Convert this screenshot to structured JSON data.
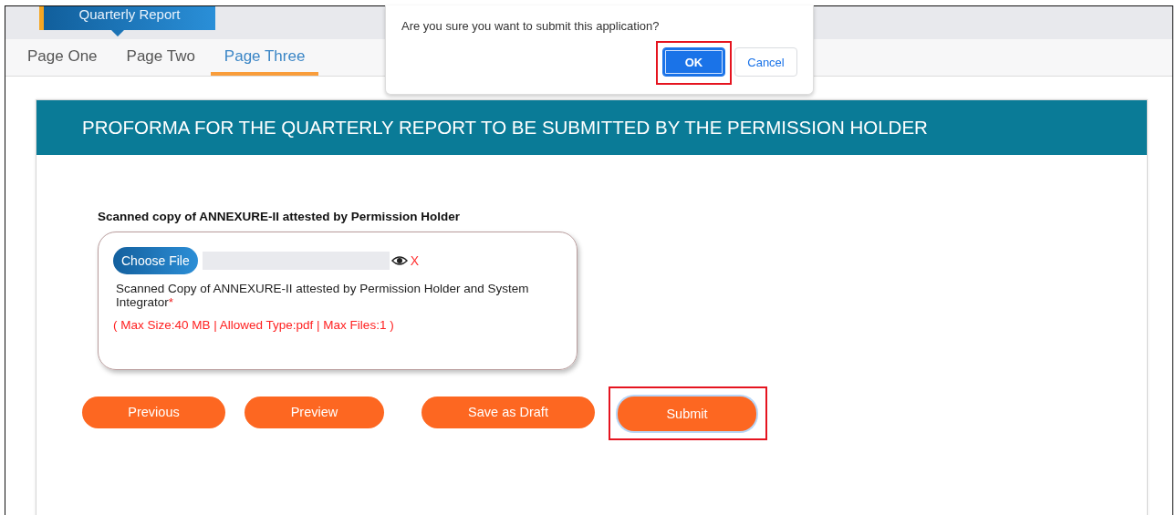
{
  "banner": {
    "title": "Quarterly Report"
  },
  "tabs": [
    {
      "label": "Page One",
      "selected": false
    },
    {
      "label": "Page Two",
      "selected": false
    },
    {
      "label": "Page Three",
      "selected": true
    }
  ],
  "form": {
    "heading": "PROFORMA FOR THE QUARTERLY REPORT TO BE SUBMITTED BY THE PERMISSION HOLDER",
    "upload": {
      "label": "Scanned copy of ANNEXURE-II attested by Permission Holder",
      "button": "Choose File",
      "remove": "X",
      "description": "Scanned Copy of ANNEXURE-II attested by Permission Holder and System Integrator",
      "required_mark": "*",
      "limits": "( Max Size:40 MB | Allowed Type:pdf | Max Files:1 )"
    },
    "buttons": [
      {
        "label": "Previous",
        "highlighted": false
      },
      {
        "label": "Preview",
        "highlighted": false
      },
      {
        "label": "Save as Draft",
        "highlighted": false
      },
      {
        "label": "Submit",
        "highlighted": true
      }
    ]
  },
  "dialog": {
    "message": "Are you sure you want to submit this application?",
    "buttons": [
      {
        "label": "OK",
        "kind": "primary",
        "highlighted": true
      },
      {
        "label": "Cancel",
        "kind": "secondary",
        "highlighted": false
      }
    ]
  }
}
